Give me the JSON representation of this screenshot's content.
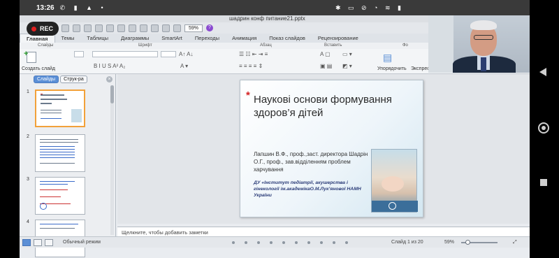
{
  "status": {
    "time": "13:26",
    "battery": "74"
  },
  "recording": {
    "label": "REC"
  },
  "app": {
    "filename": "шадрин конф питание21.pptx",
    "zoom": "59%"
  },
  "ribbon_tabs": [
    "Главная",
    "Темы",
    "Таблицы",
    "Диаграммы",
    "SmartArt",
    "Переходы",
    "Анимация",
    "Показ слайдов",
    "Рецензирование"
  ],
  "ribbon_groups": {
    "slides": "Слайды",
    "font": "Шрифт",
    "paragraph": "Абзац",
    "insert": "Вставить",
    "format": "Фо"
  },
  "ribbon_buttons": {
    "new_slide": "Создать слайд",
    "arrange": "Упорядочить",
    "express": "Экспресс"
  },
  "left_panel": {
    "tab_slides": "Слайды",
    "tab_outline": "Струк-ра",
    "thumb_numbers": [
      "1",
      "2",
      "3",
      "4"
    ]
  },
  "slide": {
    "title": "Наукові основи формування здоров’я дітей",
    "authors": "Лапшин В.Ф., проф.,заст. директора Шадрін О.Г., проф., зав.відділенням проблем харчування",
    "institution": "ДУ «Інститут педіатрії, акушерства і гінекології ім.академікаО.М.Лук’янової НАМН України"
  },
  "notes": {
    "placeholder": "Щелкните, чтобы добавить заметки"
  },
  "statusline": {
    "mode": "Обычный режим",
    "slide_counter": "Слайд 1 из 20",
    "zoom": "59%"
  }
}
